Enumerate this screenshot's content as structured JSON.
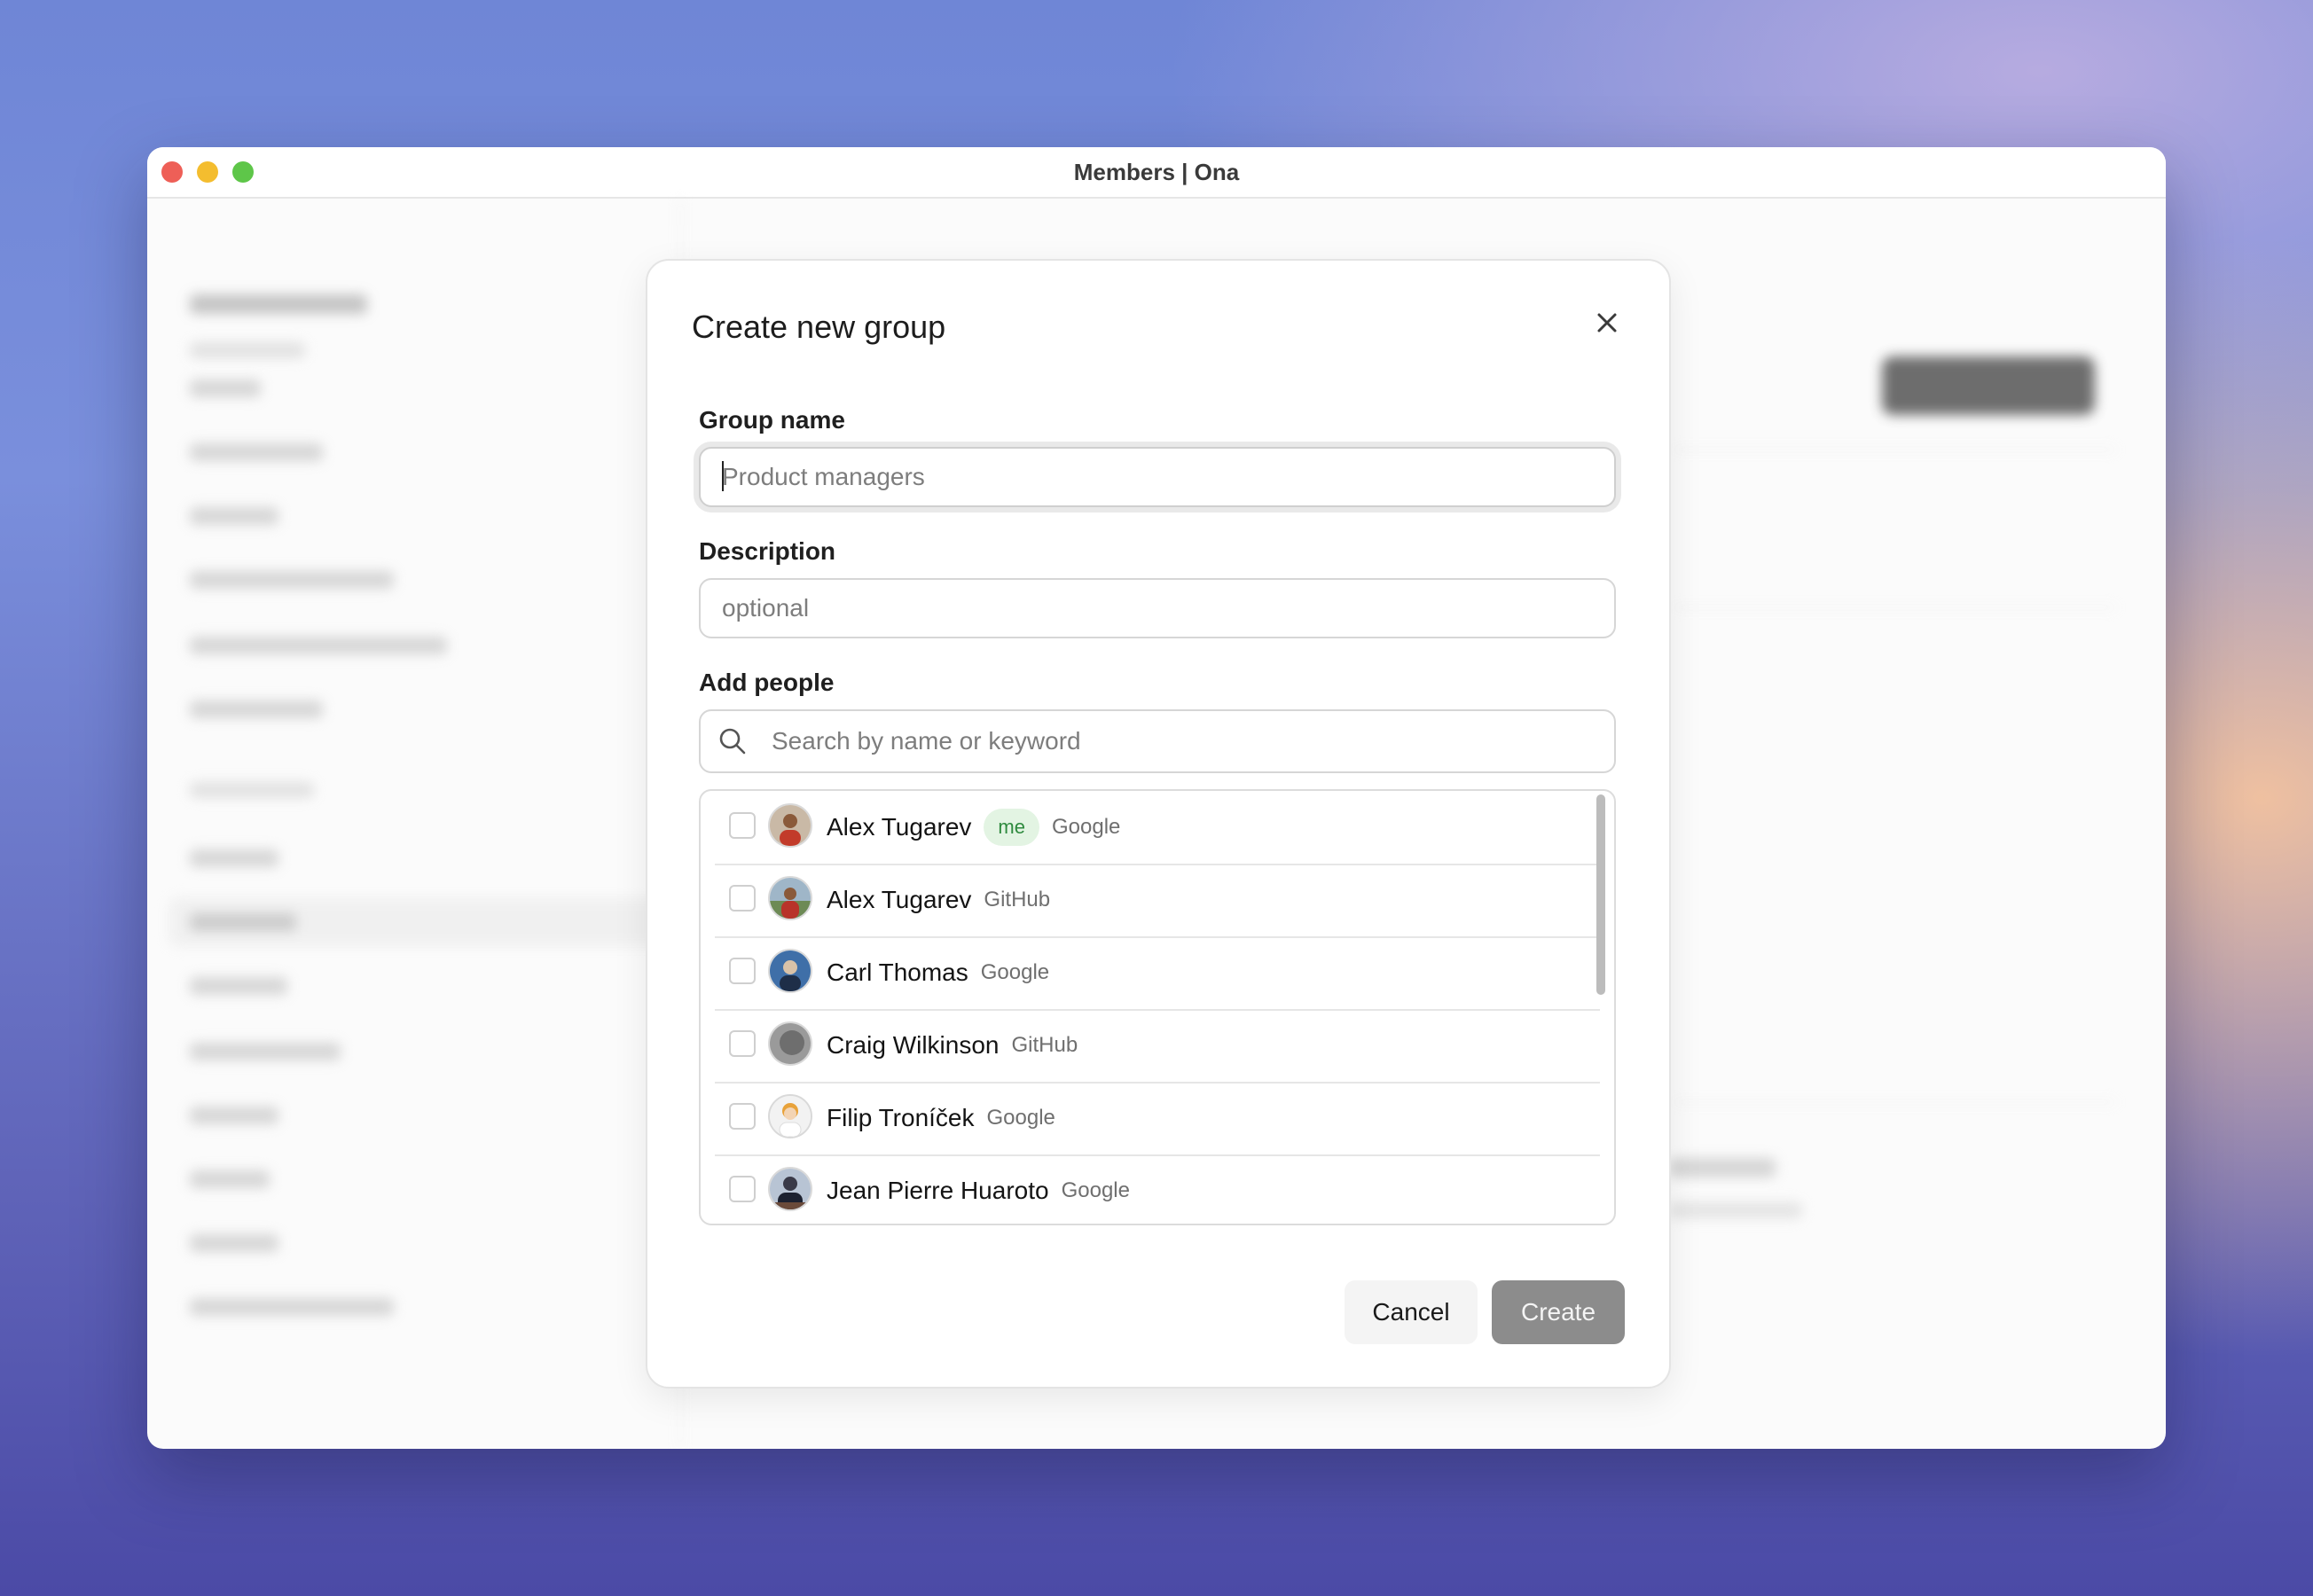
{
  "window": {
    "title": "Members | Ona"
  },
  "modal": {
    "title": "Create new group",
    "group_name": {
      "label": "Group name",
      "placeholder": "Product managers",
      "value": ""
    },
    "description": {
      "label": "Description",
      "placeholder": "optional",
      "value": ""
    },
    "add_people": {
      "label": "Add people",
      "search_placeholder": "Search by name or keyword",
      "people": [
        {
          "name": "Alex Tugarev",
          "badge": "me",
          "provider": "Google"
        },
        {
          "name": "Alex Tugarev",
          "badge": "",
          "provider": "GitHub"
        },
        {
          "name": "Carl Thomas",
          "badge": "",
          "provider": "Google"
        },
        {
          "name": "Craig Wilkinson",
          "badge": "",
          "provider": "GitHub"
        },
        {
          "name": "Filip Troníček",
          "badge": "",
          "provider": "Google"
        },
        {
          "name": "Jean Pierre Huaroto",
          "badge": "",
          "provider": "Google"
        }
      ]
    },
    "cancel_label": "Cancel",
    "create_label": "Create"
  },
  "colors": {
    "accent_disabled": "#8c8c8c",
    "badge_bg": "#e3f4e3",
    "badge_text": "#2e8a3e"
  },
  "icons": {
    "close": "close-icon",
    "search": "search-icon",
    "chat": "chat-icon"
  }
}
